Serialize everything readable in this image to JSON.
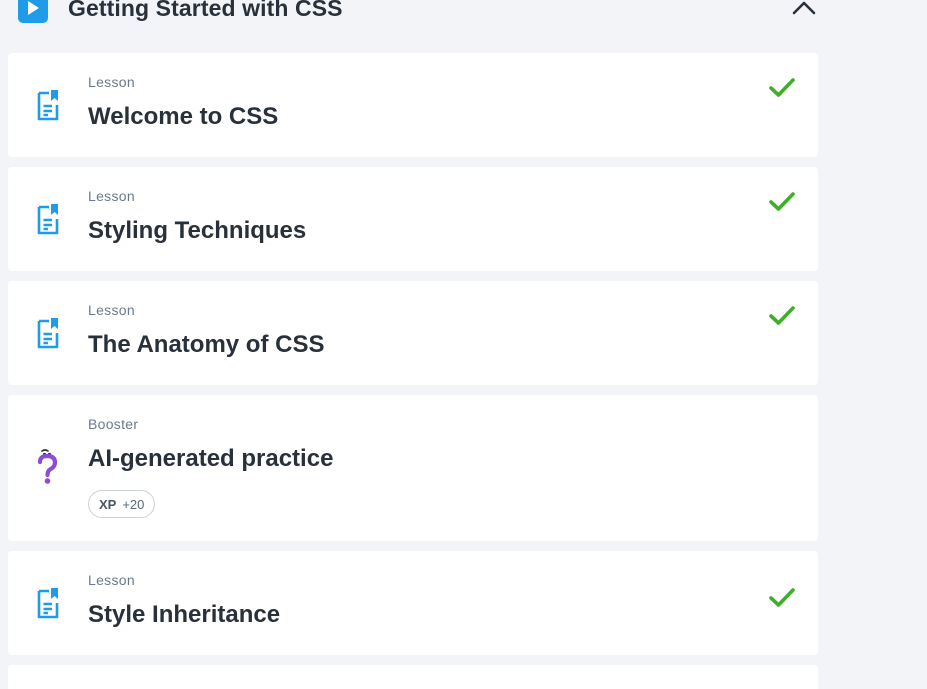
{
  "module": {
    "title": "Getting Started with CSS",
    "icon": "play-icon",
    "collapse_icon": "chevron-up-icon"
  },
  "items": [
    {
      "kind": "Lesson",
      "title": "Welcome to CSS",
      "icon": "document-icon",
      "completed": true
    },
    {
      "kind": "Lesson",
      "title": "Styling Techniques",
      "icon": "document-icon",
      "completed": true
    },
    {
      "kind": "Lesson",
      "title": "The Anatomy of CSS",
      "icon": "document-icon",
      "completed": true
    },
    {
      "kind": "Booster",
      "title": "AI-generated practice",
      "icon": "question-mark-icon",
      "completed": false,
      "xp": {
        "label": "XP",
        "value": "+20"
      }
    },
    {
      "kind": "Lesson",
      "title": "Style Inheritance",
      "icon": "document-icon",
      "completed": true
    }
  ],
  "colors": {
    "accent": "#1e9be9",
    "check": "#3fae29",
    "booster": "#8a4fd1",
    "title": "#28313b",
    "background": "#f2f4f7"
  }
}
